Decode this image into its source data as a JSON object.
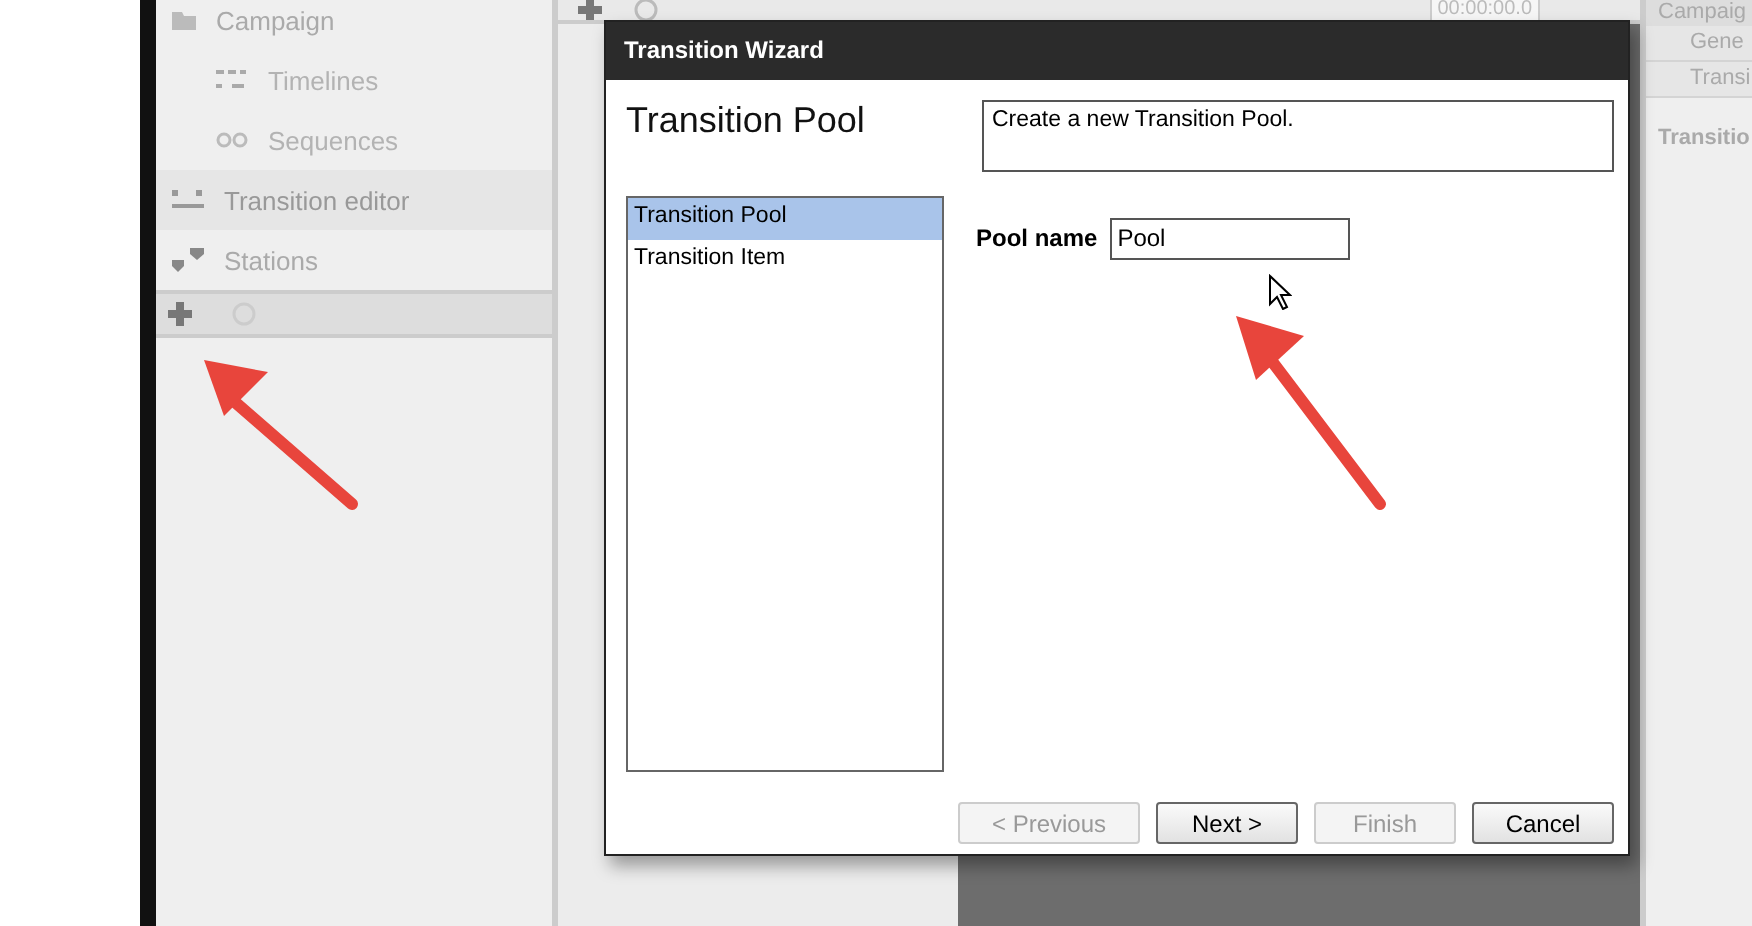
{
  "sidebar": {
    "items": [
      {
        "label": "Campaign",
        "kind": "folder",
        "highlighted": false,
        "children": [
          {
            "label": "Timelines",
            "kind": "timeline",
            "highlighted": false
          },
          {
            "label": "Sequences",
            "kind": "loop",
            "highlighted": false
          }
        ]
      },
      {
        "label": "Transition editor",
        "kind": "transition",
        "highlighted": true
      },
      {
        "label": "Stations",
        "kind": "stations",
        "highlighted": false
      }
    ]
  },
  "toolbar": {
    "time": "00:00:00.0"
  },
  "right_panel": {
    "header": "Campaig",
    "tabs": [
      {
        "label": "Gene"
      },
      {
        "label": "Transi"
      }
    ],
    "heading": "Transitio"
  },
  "dialog": {
    "title": "Transition Wizard",
    "step_title": "Transition Pool",
    "description": "Create a new Transition Pool.",
    "steps": [
      {
        "label": "Transition Pool",
        "selected": true
      },
      {
        "label": "Transition Item",
        "selected": false
      }
    ],
    "field": {
      "label": "Pool name",
      "value": "Pool"
    },
    "buttons": [
      {
        "label": "< Previous",
        "disabled": true
      },
      {
        "label": "Next >",
        "disabled": false
      },
      {
        "label": "Finish",
        "disabled": true
      },
      {
        "label": "Cancel",
        "disabled": false
      }
    ]
  }
}
